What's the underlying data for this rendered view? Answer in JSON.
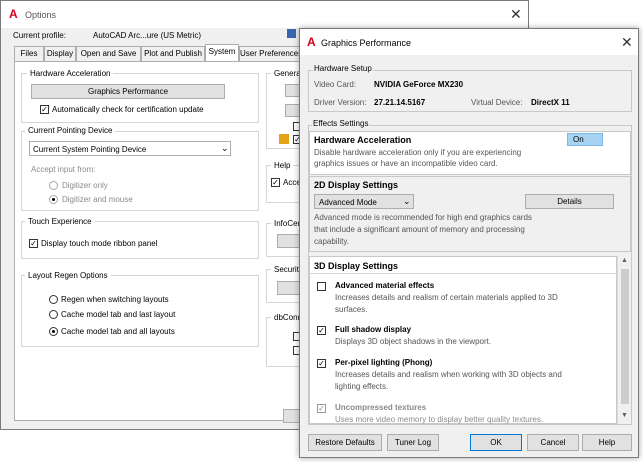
{
  "options": {
    "title": "Options",
    "current_profile_label": "Current profile:",
    "current_profile_value": "AutoCAD Arc...ure (US Metric)",
    "tabs": [
      "Files",
      "Display",
      "Open and Save",
      "Plot and Publish",
      "System",
      "User Preferences"
    ],
    "active_tab": "System",
    "hardware_accel": {
      "title": "Hardware Acceleration",
      "button": "Graphics Performance",
      "auto_check": "Automatically check for certification update"
    },
    "pointing": {
      "title": "Current Pointing Device",
      "select_value": "Current System Pointing Device",
      "accept_label": "Accept input from:",
      "opt1": "Digitizer only",
      "opt2": "Digitizer and mouse"
    },
    "touch": {
      "title": "Touch Experience",
      "check": "Display touch mode ribbon panel"
    },
    "layout_regen": {
      "title": "Layout Regen Options",
      "opt1": "Regen when switching layouts",
      "opt2": "Cache model tab and last layout",
      "opt3": "Cache model tab and all layouts"
    },
    "right_col": {
      "general": "General",
      "help": "Help",
      "help_check": "Acce",
      "infocenter": "InfoCen",
      "security": "Security",
      "dbconnect": "dbConn"
    }
  },
  "gp": {
    "title": "Graphics Performance",
    "hardware_setup": {
      "title": "Hardware Setup",
      "video_card_label": "Video Card:",
      "video_card_value": "NVIDIA GeForce MX230",
      "driver_label": "Driver Version:",
      "driver_value": "27.21.14.5167",
      "virtual_label": "Virtual Device:",
      "virtual_value": "DirectX 11"
    },
    "effects_title": "Effects Settings",
    "hw_accel": {
      "title": "Hardware Acceleration",
      "toggle": "On",
      "desc1": "Disable hardware acceleration only if you are experiencing",
      "desc2": "graphics issues or have an incompatible video card."
    },
    "display2d": {
      "title": "2D Display Settings",
      "mode": "Advanced Mode",
      "details_button": "Details",
      "desc1": "Advanced mode is recommended for high end graphics cards",
      "desc2": "that include a significant amount of memory and processing",
      "desc3": "capability."
    },
    "display3d": {
      "title": "3D Display Settings",
      "items": [
        {
          "label": "Advanced material effects",
          "desc1": "Increases details and realism of certain materials applied to 3D",
          "desc2": "surfaces.",
          "checked": false
        },
        {
          "label": "Full shadow display",
          "desc1": "Displays 3D object shadows in the viewport.",
          "desc2": "",
          "checked": true
        },
        {
          "label": "Per-pixel lighting (Phong)",
          "desc1": "Increases details and realism when working with 3D objects and",
          "desc2": "lighting effects.",
          "checked": true
        },
        {
          "label": "Uncompressed textures",
          "desc1": "Uses more video memory to display better quality textures.",
          "desc2": "",
          "checked": true
        }
      ]
    },
    "buttons": {
      "restore": "Restore Defaults",
      "tuner": "Tuner Log",
      "ok": "OK",
      "cancel": "Cancel",
      "help": "Help"
    }
  },
  "icons": {
    "app_logo": "autocad-a-icon",
    "close": "close-icon",
    "dropdown": "chevron-down-icon"
  },
  "colors": {
    "accent": "#0078d7",
    "toggle_bg": "#a6d3f2",
    "logo_red": "#d0021b"
  }
}
